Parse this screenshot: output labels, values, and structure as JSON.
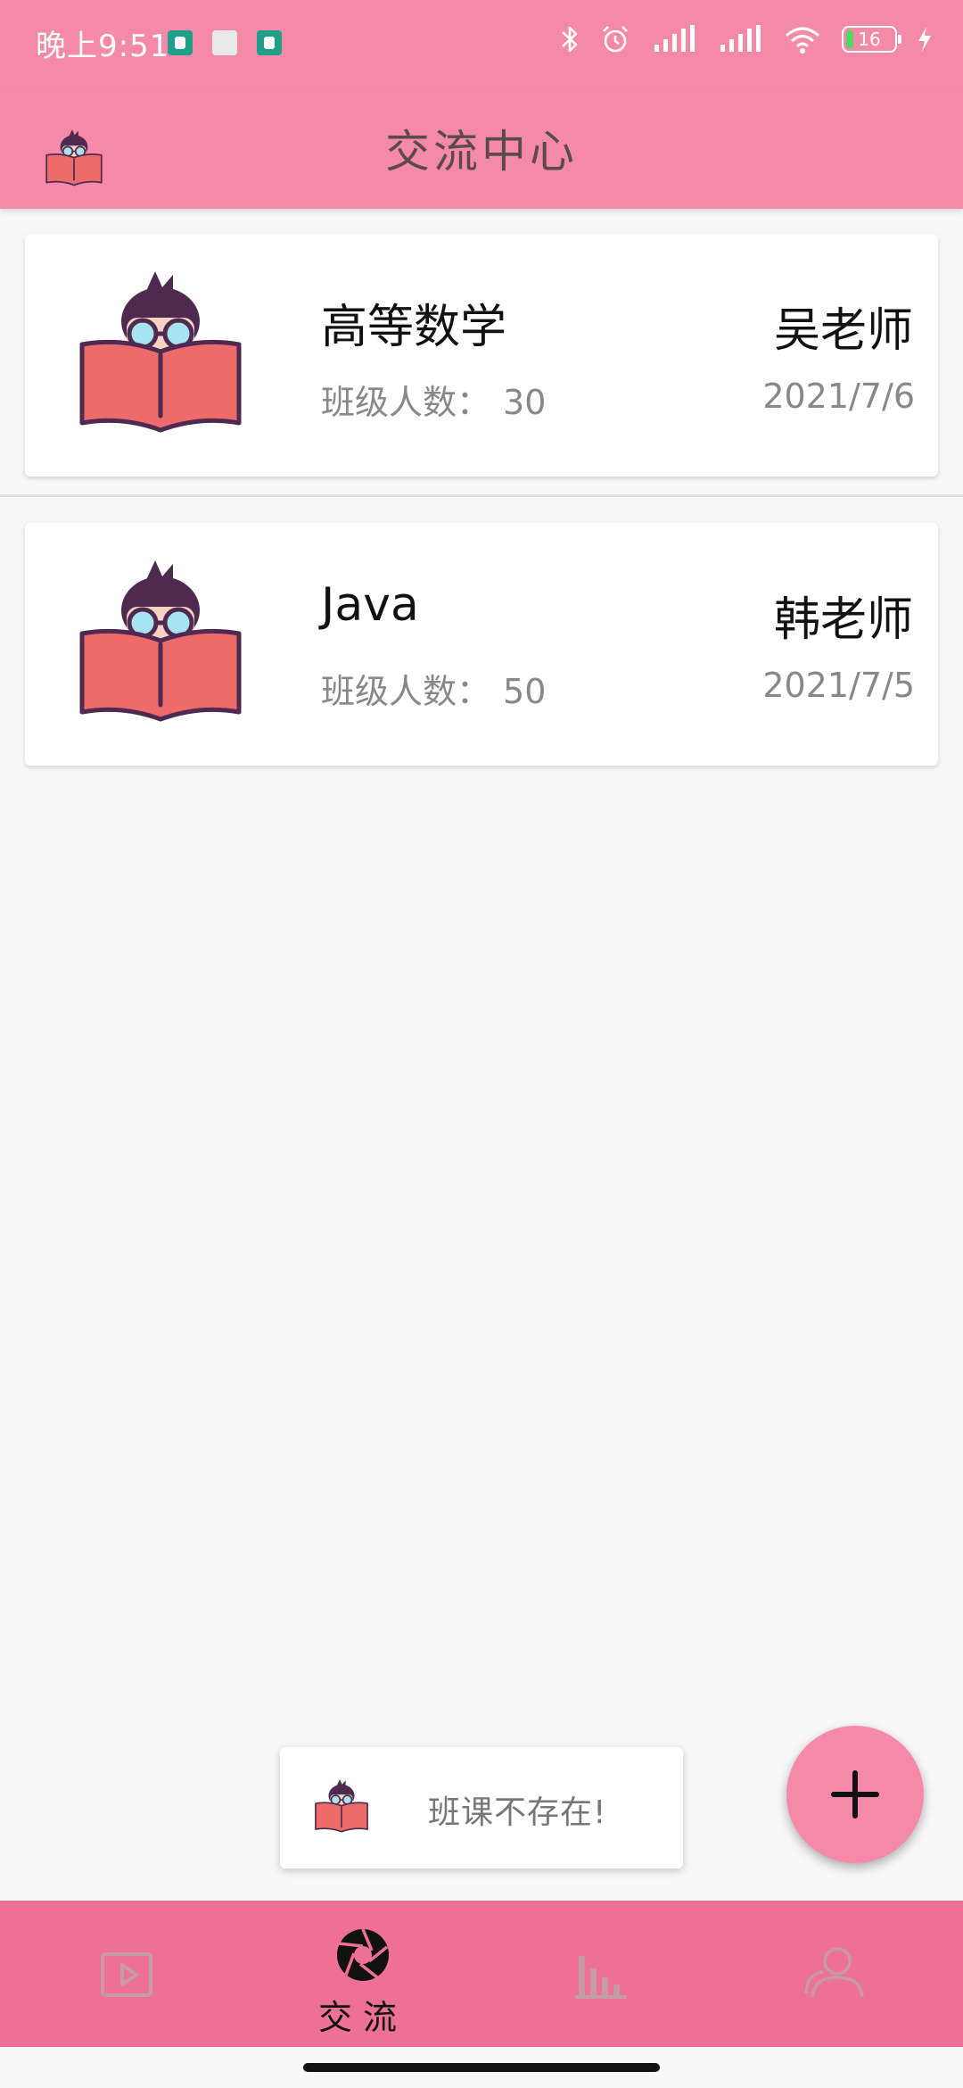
{
  "status_bar": {
    "time": "晚上9:51",
    "battery_level": "16",
    "battery_fraction": 0.16,
    "icons": [
      "android-notification-icon",
      "image-notification-icon",
      "android-notification-icon",
      "bluetooth-icon",
      "alarm-icon",
      "signal-icon",
      "signal-icon",
      "wifi-icon",
      "battery-icon",
      "charging-icon"
    ]
  },
  "app_bar": {
    "title": "交流中心"
  },
  "classes": [
    {
      "name": "高等数学",
      "count_label": "班级人数：",
      "count": "30",
      "teacher": "吴老师",
      "date": "2021/7/6"
    },
    {
      "name": "Java",
      "count_label": "班级人数：",
      "count": "50",
      "teacher": "韩老师",
      "date": "2021/7/5"
    }
  ],
  "toast": {
    "message": "班课不存在!"
  },
  "fab": {
    "icon": "plus-icon"
  },
  "bottom_nav": {
    "active_index": 1,
    "items": [
      {
        "icon": "video-icon",
        "label": ""
      },
      {
        "icon": "aperture-icon",
        "label": "交流"
      },
      {
        "icon": "bar-chart-icon",
        "label": ""
      },
      {
        "icon": "user-icon",
        "label": ""
      }
    ]
  },
  "colors": {
    "primary": "#f48aa7",
    "nav_background": "#ec7195",
    "background": "#f8f8f8",
    "inactive_icon": "#c79aa8"
  }
}
